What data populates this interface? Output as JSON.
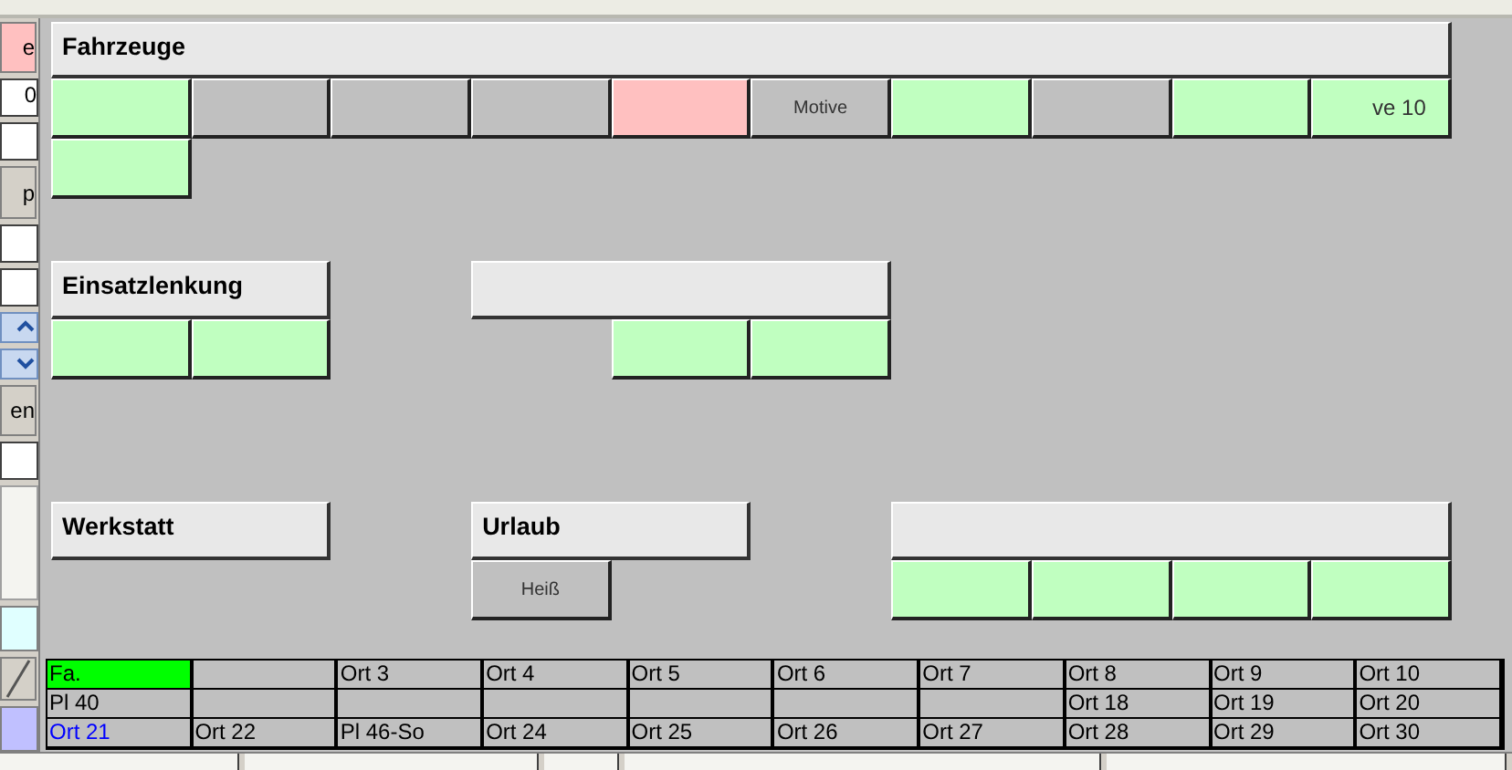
{
  "left_strip": [
    {
      "kind": "button",
      "text": "e",
      "color": "#ffc0c0"
    },
    {
      "kind": "field",
      "text": "0"
    },
    {
      "kind": "field"
    },
    {
      "kind": "button",
      "text": "p"
    },
    {
      "kind": "field"
    },
    {
      "kind": "field"
    },
    {
      "kind": "spin-up"
    },
    {
      "kind": "spin-down"
    },
    {
      "kind": "button",
      "text": "en"
    },
    {
      "kind": "field"
    },
    {
      "kind": "list"
    },
    {
      "kind": "box",
      "color": "#e0ffff"
    },
    {
      "kind": "line-button"
    },
    {
      "kind": "box",
      "color": "#c0c0ff"
    }
  ],
  "panels": [
    {
      "title": "Fahrzeuge",
      "buttons": [
        {
          "color": "#c0ffc0"
        },
        {
          "color": "#c0c0c0"
        },
        {
          "color": "#c0c0c0"
        },
        {
          "color": "#c0c0c0"
        },
        {
          "color": "#ffc0c0"
        },
        {
          "label": "Motive",
          "color": "#c0c0c0"
        },
        {
          "color": "#c0ffc0"
        },
        {
          "color": "#c0c0c0"
        },
        {
          "color": "#c0ffc0"
        },
        {
          "label": "ve 10",
          "color": "#c0ffc0"
        },
        {
          "color": "#c0ffc0"
        }
      ]
    },
    {
      "title": "Einsatzlenkung",
      "buttons": [
        {
          "color": "#c0ffc0"
        },
        {
          "color": "#c0ffc0"
        }
      ]
    },
    {
      "buttons": [
        {
          "color": "#c0ffc0"
        },
        {
          "color": "#c0ffc0"
        }
      ]
    },
    {
      "title": "Werkstatt"
    },
    {
      "title": "Urlaub",
      "buttons": [
        {
          "label": "Heiß",
          "color": "#c0c0c0"
        }
      ]
    },
    {
      "buttons": [
        {
          "color": "#c0ffc0"
        },
        {
          "color": "#c0ffc0"
        },
        {
          "color": "#c0ffc0"
        },
        {
          "color": "#c0ffc0"
        }
      ]
    }
  ],
  "locations": [
    [
      {
        "text": "Fa.",
        "highlight": true
      },
      {
        "highlight": false
      },
      {
        "text": "Ort 3",
        "highlight": false
      },
      {
        "text": "Ort 4",
        "highlight": false
      },
      {
        "text": "Ort 5",
        "highlight": false
      },
      {
        "text": "Ort 6",
        "highlight": false
      },
      {
        "text": "Ort 7",
        "highlight": false
      },
      {
        "text": "Ort 8",
        "highlight": false
      },
      {
        "text": "Ort 9",
        "highlight": false
      },
      {
        "text": "Ort 10",
        "highlight": false
      }
    ],
    [
      {
        "text": "Pl 40",
        "highlight": false
      },
      {
        "highlight": false
      },
      {
        "highlight": false
      },
      {
        "highlight": false
      },
      {
        "highlight": false
      },
      {
        "highlight": false
      },
      {
        "highlight": false
      },
      {
        "text": "Ort 18",
        "highlight": false
      },
      {
        "text": "Ort 19",
        "highlight": false
      },
      {
        "text": "Ort 20",
        "highlight": false
      }
    ],
    [
      {
        "text": "Ort 21",
        "highlight": false,
        "color": "#0000ff"
      },
      {
        "text": "Ort 22",
        "highlight": false
      },
      {
        "text": "Pl 46-So",
        "highlight": false
      },
      {
        "text": "Ort 24",
        "highlight": false
      },
      {
        "text": "Ort 25",
        "highlight": false
      },
      {
        "text": "Ort 26",
        "highlight": false
      },
      {
        "text": "Ort 27",
        "highlight": false
      },
      {
        "text": "Ort 28",
        "highlight": false
      },
      {
        "text": "Ort 29",
        "highlight": false
      },
      {
        "text": "Ort 30",
        "highlight": false
      }
    ]
  ]
}
